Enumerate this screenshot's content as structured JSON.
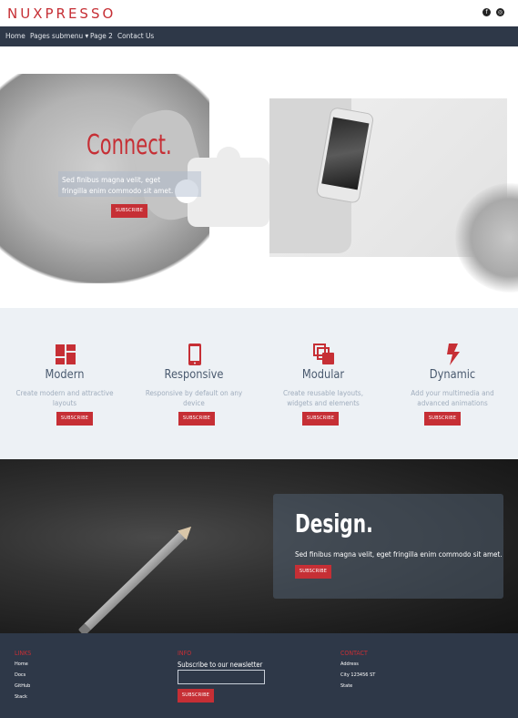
{
  "brand": {
    "name": "NUXPRESSO"
  },
  "social": [
    {
      "icon": "facebook-icon",
      "glyph": "f"
    },
    {
      "icon": "instagram-icon",
      "glyph": "◎"
    }
  ],
  "nav": {
    "items": [
      {
        "label": "Home"
      },
      {
        "label": "Pages submenu ▾"
      },
      {
        "label": "Page 2"
      },
      {
        "label": "Contact Us"
      }
    ]
  },
  "hero": {
    "title": "Connect.",
    "text": "Sed finibus magna velit, eget fringilla enim commodo sit amet.",
    "button": "SUBSCRIBE"
  },
  "features": [
    {
      "icon": "dashboard-icon",
      "title": "Modern",
      "description": "Create modern and attractive layouts",
      "button": "SUBSCRIBE"
    },
    {
      "icon": "smartphone-icon",
      "title": "Responsive",
      "description": "Responsive by default on any device",
      "button": "SUBSCRIBE"
    },
    {
      "icon": "layers-icon",
      "title": "Modular",
      "description": "Create reusable layouts, widgets and elements",
      "button": "SUBSCRIBE"
    },
    {
      "icon": "lightning-icon",
      "title": "Dynamic",
      "description": "Add your multimedia and advanced animations",
      "button": "SUBSCRIBE"
    }
  ],
  "design": {
    "title": "Design.",
    "text": "Sed finibus magna velit, eget fringilla enim commodo sit amet.",
    "button": "SUBSCRIBE"
  },
  "footer": {
    "links": {
      "heading": "LINKS",
      "items": [
        "Home",
        "Docs",
        "GitHub",
        "Stack"
      ]
    },
    "info": {
      "heading": "INFO",
      "subscribe_label": "Subscribe to our newsletter",
      "input_value": "",
      "button": "SUBSCRIBE"
    },
    "contact": {
      "heading": "CONTACT",
      "lines": [
        "Address",
        "City 123456 ST",
        "State"
      ]
    }
  },
  "colors": {
    "accent": "#c62f35",
    "nav_bg": "#2e3848",
    "features_bg": "#edf1f5"
  }
}
